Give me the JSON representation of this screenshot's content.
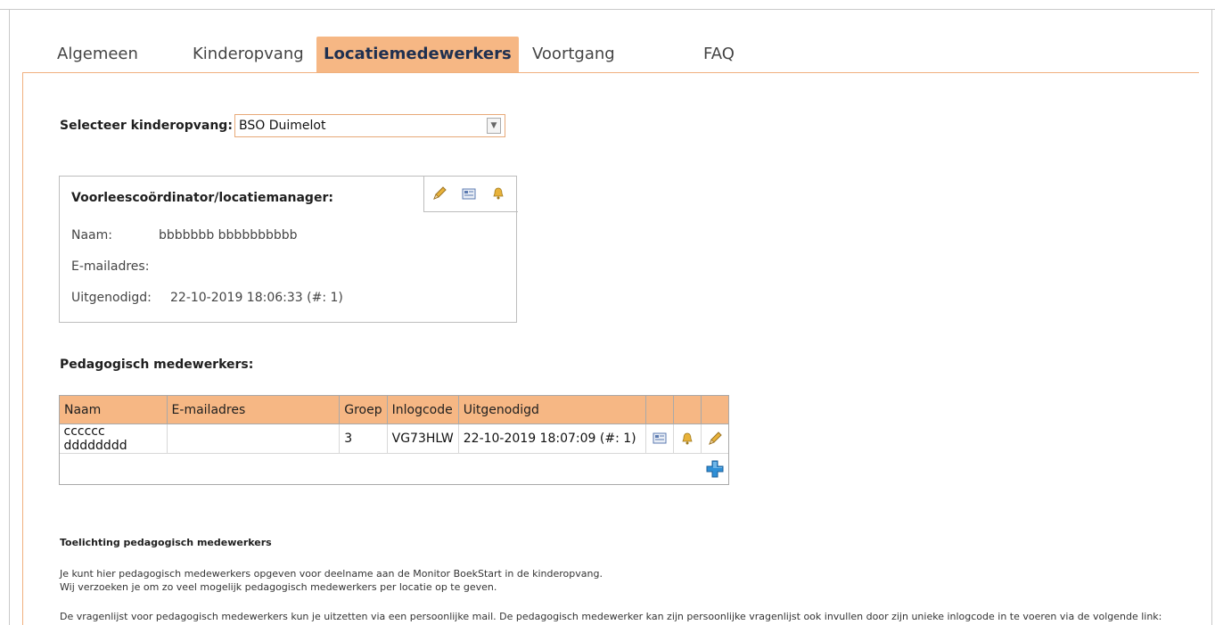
{
  "tabs": [
    {
      "label": "Algemeen",
      "active": false
    },
    {
      "label": "Kinderopvang",
      "active": false
    },
    {
      "label": "Locatiemedewerkers",
      "active": true
    },
    {
      "label": "Voortgang",
      "active": false
    },
    {
      "label": "FAQ",
      "active": false
    }
  ],
  "selector": {
    "label": "Selecteer kinderopvang:",
    "value": "BSO Duimelot"
  },
  "coordinator": {
    "title": "Voorleescoördinator/locatiemanager:",
    "icons": [
      "pencil-icon",
      "mail-icon",
      "bell-icon"
    ],
    "name_label": "Naam:",
    "name_value": "bbbbbbb bbbbbbbbbb",
    "email_label": "E-mailadres:",
    "email_value": "",
    "invited_label": "Uitgenodigd:",
    "invited_value": "22-10-2019 18:06:33 (#: 1)"
  },
  "employees": {
    "heading": "Pedagogisch medewerkers:",
    "columns": [
      "Naam",
      "E-mailadres",
      "Groep",
      "Inlogcode",
      "Uitgenodigd"
    ],
    "rows": [
      {
        "naam": "cccccc dddddddd",
        "email": "",
        "groep": "3",
        "inlogcode": "VG73HLW",
        "uitgenodigd": "22-10-2019 18:07:09 (#: 1)"
      }
    ],
    "row_icons": [
      "mail-icon",
      "bell-icon",
      "pencil-icon"
    ],
    "add_icon": "plus-icon"
  },
  "explanation": {
    "title": "Toelichting pedagogisch medewerkers",
    "line1": "Je kunt hier pedagogisch medewerkers opgeven voor deelname aan de Monitor BoekStart in de kinderopvang.",
    "line2": "Wij verzoeken je om zo veel mogelijk pedagogisch medewerkers per locatie op te geven.",
    "line3": "De vragenlijst voor pedagogisch medewerkers kun je uitzetten via een persoonlijke mail. De pedagogisch medewerker kan zijn persoonlijke vragenlijst ook invullen door zijn unieke inlogcode in te voeren via de volgende link:"
  },
  "colors": {
    "accent": "#f6b784",
    "accent_line": "#f0b07e",
    "border": "#bdbdbd",
    "plus_blue": "#2f8fd6",
    "bell_yellow": "#e8b23a"
  }
}
